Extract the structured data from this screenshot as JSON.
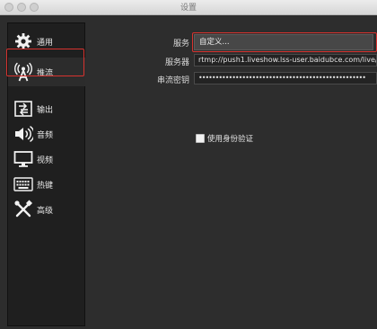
{
  "window": {
    "title": "设置"
  },
  "sidebar": {
    "items": [
      {
        "label": "通用",
        "icon": "gear-icon"
      },
      {
        "label": "推流",
        "icon": "antenna-icon"
      },
      {
        "label": "输出",
        "icon": "output-icon"
      },
      {
        "label": "音频",
        "icon": "speaker-icon"
      },
      {
        "label": "视频",
        "icon": "monitor-icon"
      },
      {
        "label": "热键",
        "icon": "keyboard-icon"
      },
      {
        "label": "高级",
        "icon": "tools-icon"
      }
    ]
  },
  "stream": {
    "service_label": "服务",
    "service_value": "自定义...",
    "server_label": "服务器",
    "server_value": "rtmp://push1.liveshow.lss-user.baidubce.com/live/",
    "key_label": "串流密钥",
    "key_value": "••••••••••••••••••••••••••••••••••••••••••••••••••",
    "auth_label": "使用身份验证"
  },
  "colors": {
    "highlight": "#d8332f",
    "panel": "#2d2d2d",
    "sidebar": "#1f1f1f"
  }
}
